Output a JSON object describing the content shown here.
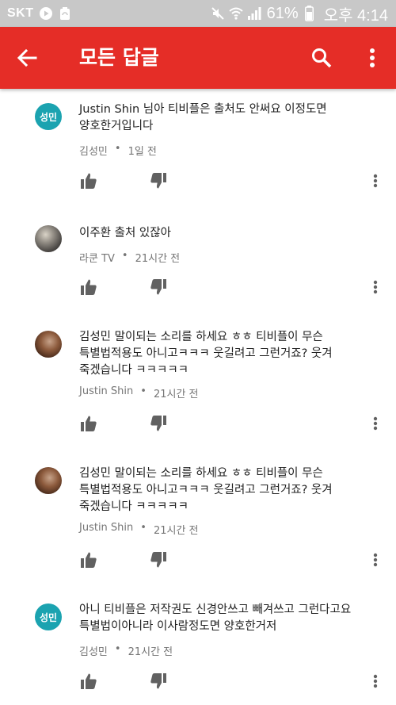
{
  "status_bar": {
    "carrier": "SKT",
    "battery_percent": "61%",
    "time": "오후 4:14",
    "icons": [
      "play-icon",
      "recycle-icon",
      "mute-icon",
      "wifi-icon",
      "signal-icon",
      "battery-icon"
    ]
  },
  "app_bar": {
    "title": "모든 답글",
    "back_icon": "arrow-left-icon",
    "search_icon": "search-icon",
    "more_icon": "more-vert-icon",
    "color": "#e52d27"
  },
  "comments": [
    {
      "avatar_letter": "성민",
      "text": "Justin Shin 님아 티비플은 출처도 안써요 이정도면 양호한거입니다",
      "author": "김성민",
      "time": "1일 전"
    },
    {
      "avatar_letter": "",
      "text": "이주환 출처 있잖아",
      "author": "라쿤 TV",
      "time": "21시간 전"
    },
    {
      "avatar_letter": "",
      "text": "김성민 말이되는 소리를 하세요 ㅎㅎ 티비플이 무슨 특별법적용도 아니고ㅋㅋㅋ 웃길려고 그런거죠? 웃겨 죽겠습니다 ㅋㅋㅋㅋㅋ",
      "author": "Justin Shin",
      "time": "21시간 전"
    },
    {
      "avatar_letter": "",
      "text": "김성민 말이되는 소리를 하세요 ㅎㅎ 티비플이 무슨 특별법적용도 아니고ㅋㅋㅋ 웃길려고 그런거죠? 웃겨 죽겠습니다 ㅋㅋㅋㅋㅋ",
      "author": "Justin Shin",
      "time": "21시간 전"
    },
    {
      "avatar_letter": "성민",
      "text": "아니 티비플은 저작권도 신경안쓰고 빼겨쓰고 그런다고요 특별법이아니라 이사람정도면 양호한거저",
      "author": "김성민",
      "time": "21시간 전"
    }
  ],
  "comment_icons": {
    "like": "thumb-up-icon",
    "dislike": "thumb-down-icon",
    "more": "more-vert-icon"
  }
}
